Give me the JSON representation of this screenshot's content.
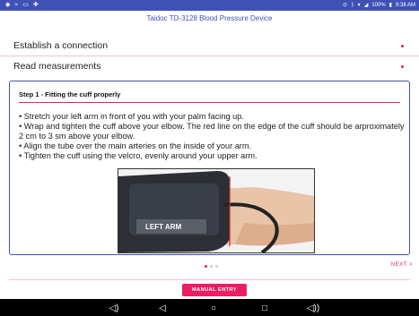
{
  "status_bar": {
    "left_icons": [
      "app-icon",
      "wifi-icon",
      "image-icon",
      "notification-icon"
    ],
    "right_icons": [
      "location-icon",
      "bluetooth-icon",
      "signal-icon",
      "battery-icon"
    ],
    "battery_text": "100%",
    "time": "9:38 AM"
  },
  "app": {
    "title": "Taidoc TD-3128 Blood Pressure Device"
  },
  "sections": [
    {
      "label": "Establish a connection"
    },
    {
      "label": "Read measurements"
    }
  ],
  "step": {
    "title": "Step 1 - Fitting the cuff properly",
    "instructions": [
      "• Stretch your left arm in front of you with your palm facing up.",
      "• Wrap and tighten the cuff above your elbow. The red line on the edge of the cuff should be arproximately 2 cm to 3 sm above your elbow.",
      "• Align the tube over the main arteries on the inside of your arm.",
      "• Tighten the cuff using the velcro, evenly around your upper arm."
    ],
    "image_text": "LEFT ARM"
  },
  "pager": {
    "current": 1,
    "total": 3
  },
  "next_label": "NEXT",
  "next_icon": ">",
  "manual_entry_label": "MANUAL ENTRY",
  "colors": {
    "accent": "#e91e63",
    "primary": "#3f51b5"
  },
  "nav_icons": [
    "volume-down-icon",
    "back-icon",
    "home-icon",
    "recents-icon",
    "volume-up-icon"
  ]
}
